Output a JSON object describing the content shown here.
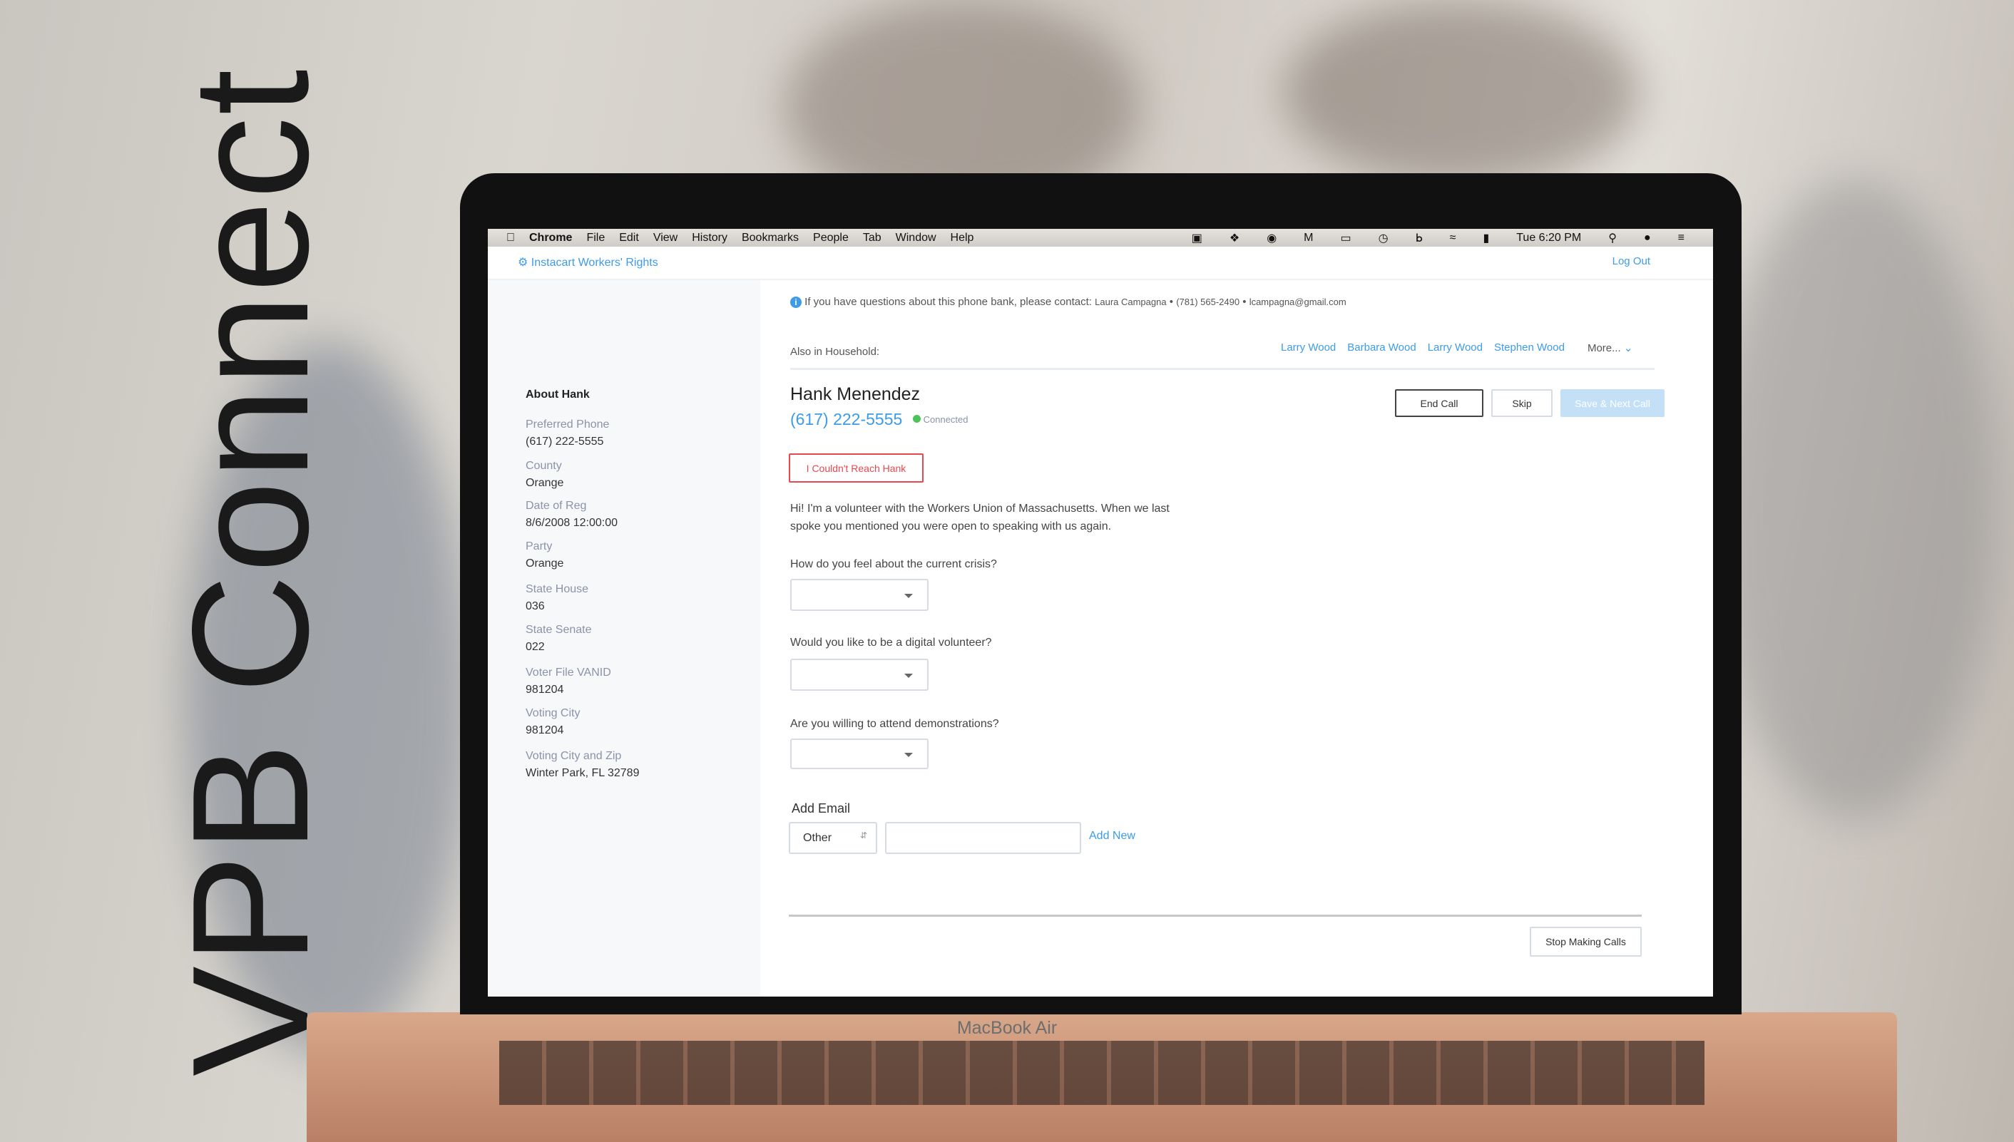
{
  "brand_title": "VPB Connect",
  "device_label": "MacBook Air",
  "menubar": {
    "app": "Chrome",
    "items": [
      "File",
      "Edit",
      "View",
      "History",
      "Bookmarks",
      "People",
      "Tab",
      "Window",
      "Help"
    ],
    "clock": "Tue 6:20 PM"
  },
  "header": {
    "org": "Instacart Workers' Rights",
    "logout": "Log Out"
  },
  "info": {
    "text": "If you have questions about this phone bank, please contact:",
    "contact_name": "Laura Campagna",
    "contact_phone": "(781) 565-2490",
    "contact_email": "lcampagna@gmail.com"
  },
  "household": {
    "label": "Also in Household:",
    "members": [
      "Larry Wood",
      "Barbara Wood",
      "Larry Wood",
      "Stephen Wood"
    ],
    "more": "More..."
  },
  "contact": {
    "name": "Hank Menendez",
    "phone": "(617) 222-5555",
    "status": "Connected",
    "status_color": "#4cc35a"
  },
  "actions": {
    "end_call": "End Call",
    "skip": "Skip",
    "save_next": "Save & Next Call",
    "couldnt_reach": "I Couldn't Reach Hank",
    "stop": "Stop Making Calls"
  },
  "script": {
    "line1": "Hi! I'm a volunteer with the Workers Union of Massachusetts. When we last",
    "line2": "spoke you mentioned you were open to speaking with us again."
  },
  "questions": [
    "How do you feel about the current crisis?",
    "Would you like to be a digital volunteer?",
    "Are you willing to attend demonstrations?"
  ],
  "email": {
    "label": "Add Email",
    "type": "Other",
    "value": "",
    "add_new": "Add New"
  },
  "sidebar": {
    "title": "About Hank",
    "fields": [
      {
        "label": "Preferred Phone",
        "value": "(617) 222-5555"
      },
      {
        "label": "County",
        "value": "Orange"
      },
      {
        "label": "Date of Reg",
        "value": "8/6/2008 12:00:00"
      },
      {
        "label": "Party",
        "value": "Orange"
      },
      {
        "label": "State House",
        "value": "036"
      },
      {
        "label": "State Senate",
        "value": "022"
      },
      {
        "label": "Voter File VANID",
        "value": "981204"
      },
      {
        "label": "Voting City",
        "value": "981204"
      },
      {
        "label": "Voting City and Zip",
        "value": "Winter Park, FL 32789"
      }
    ]
  },
  "colors": {
    "link": "#3d9be9",
    "danger": "#e8474f",
    "disabled_button": "#c3e0f7"
  }
}
